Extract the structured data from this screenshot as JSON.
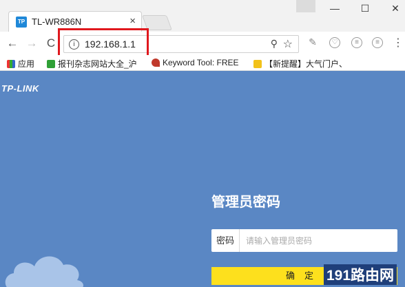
{
  "tab": {
    "favicon": "TP",
    "title": "TL-WR886N"
  },
  "window": {
    "minimize": "—",
    "maximize": "☐",
    "close": "✕"
  },
  "toolbar": {
    "back": "←",
    "forward": "→",
    "reload": "C",
    "url": "192.168.1.1"
  },
  "bookmarks": [
    {
      "label": "应用"
    },
    {
      "label": "报刊杂志网站大全_沪"
    },
    {
      "label": "Keyword Tool: FREE"
    },
    {
      "label": "【新提醒】大气门户、"
    }
  ],
  "page": {
    "logo": "TP-LINK",
    "heading": "管理员密码",
    "password_label": "密码",
    "password_placeholder": "请输入管理员密码",
    "confirm_label": "确定"
  },
  "watermark": "191路由网",
  "colors": {
    "page_bg": "#5a87c4",
    "button_bg": "#fde01d",
    "highlight": "#e0181e"
  }
}
